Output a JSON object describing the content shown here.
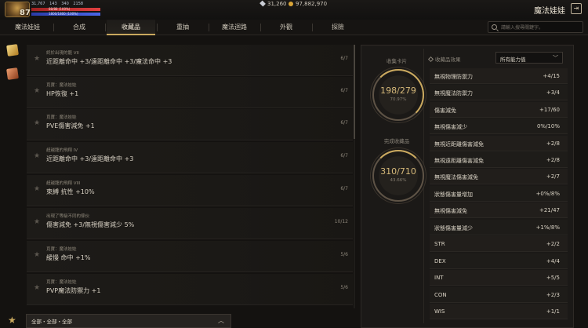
{
  "player": {
    "level": "87",
    "stats": [
      "31,767",
      "143",
      "340",
      "2158"
    ],
    "hp_label": "88/88 (100%)",
    "mp_label": "1800/1800 (100%)"
  },
  "currency": {
    "diamonds": "31,260",
    "gold": "97,882,970"
  },
  "window_title": "魔法娃娃",
  "tabs": [
    "魔法娃娃",
    "合成",
    "收藏品",
    "重抽",
    "魔法迴路",
    "外觀",
    "探險"
  ],
  "active_tab": "收藏品",
  "search": {
    "placeholder": "請輸入搜尋關鍵字。",
    "value": ""
  },
  "collection_list": [
    {
      "source": "終於出現的龍 VII",
      "reward": "近距離命中 +3/遠距離命中 +3/魔法命中 +3",
      "count": "6/7"
    },
    {
      "source": "覓寶：魔法娃娃",
      "reward": "HP恢復 +1",
      "count": "6/7"
    },
    {
      "source": "覓寶：魔法娃娃",
      "reward": "PVE傷害減免 +1",
      "count": "6/7"
    },
    {
      "source": "超越龍的飛翔 IV",
      "reward": "近距離命中 +3/遠距離命中 +3",
      "count": "6/7"
    },
    {
      "source": "超越龍的飛翔 VIII",
      "reward": "束縛 抗性 +10%",
      "count": "6/7"
    },
    {
      "source": "出現了等級不同的傢伙",
      "reward": "傷害減免 +3/無視傷害減少 5%",
      "count": "10/12"
    },
    {
      "source": "覓寶：魔法娃娃",
      "reward": "緩慢 命中 +1%",
      "count": "5/6"
    },
    {
      "source": "覓寶：魔法娃娃",
      "reward": "PVP魔法防禦力 +1",
      "count": "5/6"
    }
  ],
  "filter": {
    "label": "全部・全部・全部"
  },
  "summary": {
    "cards_label": "收集卡片",
    "cards_value": "198/279",
    "cards_fraction": 0.7097,
    "cards_pct": "70.97%",
    "items_label": "完成收藏品",
    "items_value": "310/710",
    "items_fraction": 0.4366,
    "items_pct": "43.66%"
  },
  "stats_panel": {
    "header": "收藏品效果",
    "dropdown": "所有能力值",
    "rows": [
      {
        "name": "無視物理防禦力",
        "value": "+4/15"
      },
      {
        "name": "無視魔法防禦力",
        "value": "+3/4"
      },
      {
        "name": "傷害減免",
        "value": "+17/60"
      },
      {
        "name": "無視傷害減少",
        "value": "0%/10%"
      },
      {
        "name": "無視近距離傷害減免",
        "value": "+2/8"
      },
      {
        "name": "無視遠距離傷害減免",
        "value": "+2/8"
      },
      {
        "name": "無視魔法傷害減免",
        "value": "+2/7"
      },
      {
        "name": "狀態傷害量增加",
        "value": "+0%/8%"
      },
      {
        "name": "無視傷害減免",
        "value": "+21/47"
      },
      {
        "name": "狀態傷害量減少",
        "value": "+1%/8%"
      },
      {
        "name": "STR",
        "value": "+2/2"
      },
      {
        "name": "DEX",
        "value": "+4/4"
      },
      {
        "name": "INT",
        "value": "+5/5"
      },
      {
        "name": "CON",
        "value": "+2/3"
      },
      {
        "name": "WIS",
        "value": "+1/1"
      }
    ]
  },
  "colors": {
    "accent_gold": "#c9a85e",
    "background": "#141210",
    "value_highlight": "#ffd27a"
  }
}
